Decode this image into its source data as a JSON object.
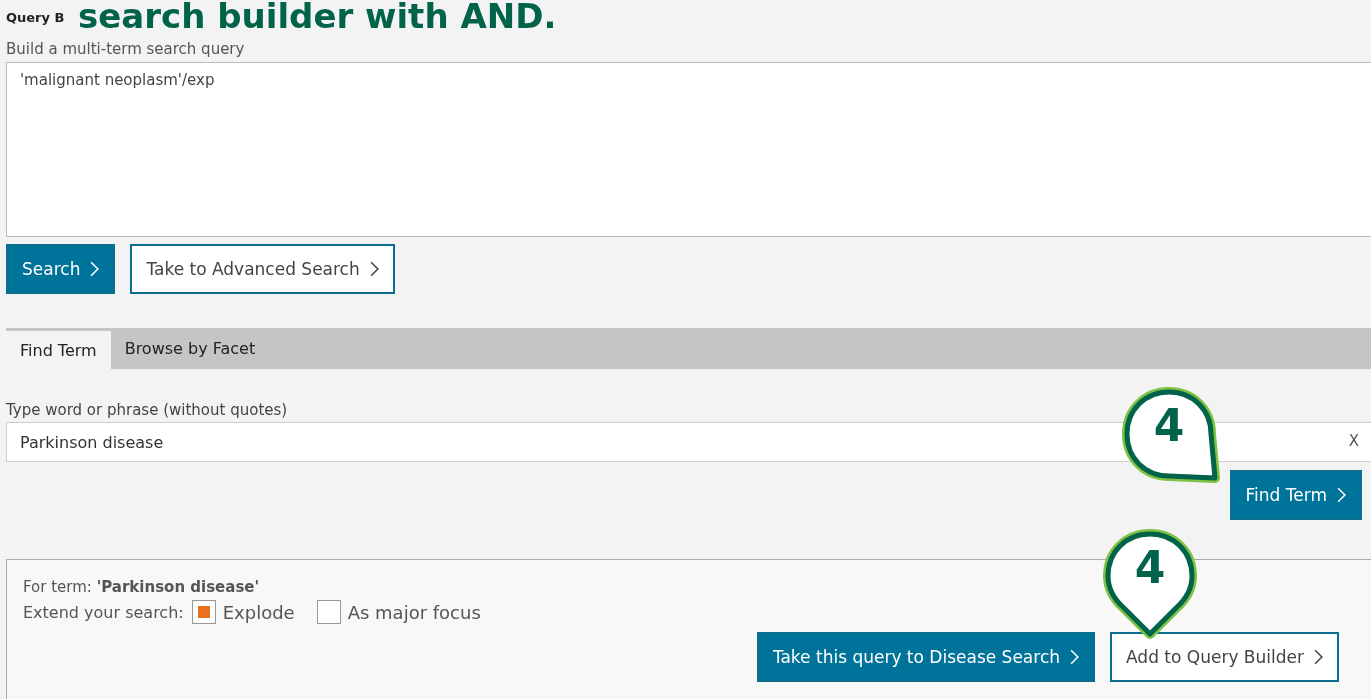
{
  "overlay_heading": "search builder with AND.",
  "query_builder": {
    "title": "Query B",
    "label": "Build a multi-term search query",
    "query": "'malignant neoplasm'/exp"
  },
  "query_buttons": [
    {
      "label": "Search",
      "kind": "primary"
    },
    {
      "label": "Take to Advanced Search",
      "kind": "secondary"
    }
  ],
  "tabs": [
    {
      "label": "Find Term",
      "selected": true
    },
    {
      "label": "Browse by Facet",
      "selected": false
    }
  ],
  "find_term": {
    "label": "Type word or phrase (without quotes)",
    "value": "Parkinson disease",
    "clear": "X",
    "button": "Find Term"
  },
  "result": {
    "term_label": "For term: **'Parkinson disease'**",
    "extend_label": "Extend your search:",
    "options": [
      {
        "label": "Explode",
        "checked": true
      },
      {
        "label": "As major focus",
        "checked": false
      }
    ],
    "buttons": [
      {
        "label": "Take this query to Disease Search",
        "kind": "primary"
      },
      {
        "label": "Add to Query Builder",
        "kind": "secondary"
      }
    ]
  },
  "markers": [
    {
      "label": "4",
      "kind": "tail-right"
    },
    {
      "label": "4",
      "kind": "tail-down"
    }
  ]
}
